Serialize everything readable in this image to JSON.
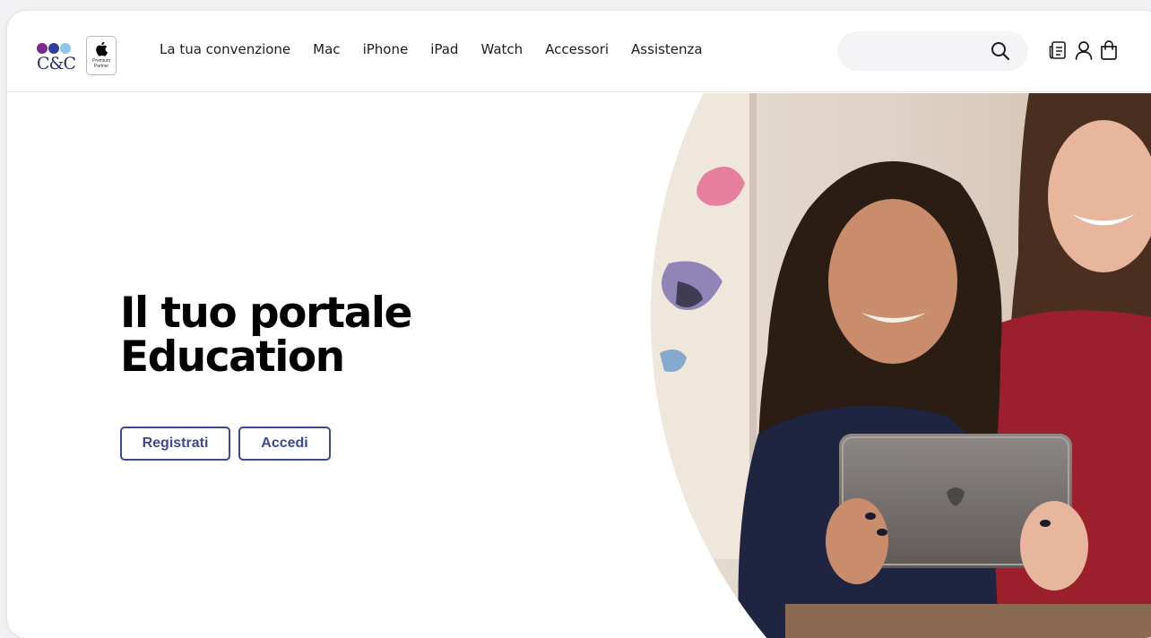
{
  "brand": {
    "logo_text": "C&C",
    "dot_colors": [
      "#7b2a8c",
      "#2e3f9e",
      "#8ec6e8"
    ],
    "badge_line1": "Premium",
    "badge_line2": "Partner"
  },
  "nav": {
    "items": [
      {
        "label": "La tua convenzione"
      },
      {
        "label": "Mac"
      },
      {
        "label": "iPhone"
      },
      {
        "label": "iPad"
      },
      {
        "label": "Watch"
      },
      {
        "label": "Accessori"
      },
      {
        "label": "Assistenza"
      }
    ]
  },
  "search": {
    "placeholder": "",
    "value": "",
    "icon": "search-icon"
  },
  "header_icons": [
    "document-list-icon",
    "user-icon",
    "shopping-bag-icon"
  ],
  "hero": {
    "title_line1": "Il tuo portale",
    "title_line2": "Education",
    "register_label": "Registrati",
    "login_label": "Accedi"
  },
  "colors": {
    "accent": "#3d4890",
    "text": "#1d1d1f",
    "search_bg": "#f4f4f6"
  }
}
